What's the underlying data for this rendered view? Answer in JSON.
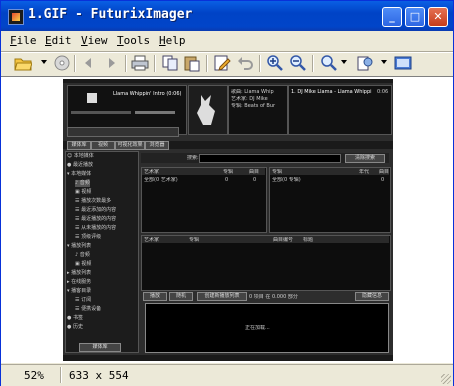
{
  "window": {
    "title": "1.GIF - FuturixImager"
  },
  "menu": [
    {
      "label": "File",
      "key": "F",
      "rest": "ile"
    },
    {
      "label": "Edit",
      "key": "E",
      "rest": "dit"
    },
    {
      "label": "View",
      "key": "V",
      "rest": "iew"
    },
    {
      "label": "Tools",
      "key": "T",
      "rest": "ools"
    },
    {
      "label": "Help",
      "key": "H",
      "rest": "elp"
    }
  ],
  "status": {
    "zoom": "52%",
    "dimensions": "633 x 554"
  },
  "inner": {
    "player_title": "Llama Whippin' Intro (0:06)",
    "song_lines": [
      "歌曲: Llama Whip",
      "艺术家: DJ Mike",
      "专辑: Beats of Bur"
    ],
    "playlist_item": "1. DJ Mike Llama - Llama Whippi",
    "playlist_time": "0:06",
    "tabs": [
      "媒体库",
      "视频",
      "可视化效果",
      "浏览器"
    ],
    "search_label": "搜索:",
    "clear_search": "清除搜索",
    "artist_headers": [
      "艺术家",
      "专辑",
      "曲目"
    ],
    "artist_row": [
      "全部(0 艺术家)",
      "0",
      "0"
    ],
    "album_headers": [
      "专辑",
      "年代",
      "曲目"
    ],
    "album_row": [
      "全部(0 专辑)",
      "",
      "0"
    ],
    "track_headers": [
      "艺术家",
      "专辑",
      "曲目编号",
      "标题"
    ],
    "bottom_buttons": [
      "播放",
      "随机",
      "创建新播放列表",
      "隐藏信息"
    ],
    "count_text": "0 项目 在 0.000 部分",
    "loading": "正在加载...",
    "library_button": "媒体库",
    "tree": [
      "☺ 本地媒体",
      "● 最近播放",
      "▾ 本地媒体",
      "♪ 音频",
      "▣ 视频",
      "☰ 播放次数最多",
      "☰ 最近添加的内容",
      "☰ 最近播放的内容",
      "☰ 从未播放的内容",
      "☰ 顶级评级",
      "▾ 播放列表",
      "♪ 音频",
      "▣ 视频",
      "▸ 播放列表",
      "▸ 在线服务",
      "▾ 播客目录",
      "☰ 订阅",
      "☰ 便携设备",
      "● 书签",
      "● 历史"
    ]
  }
}
